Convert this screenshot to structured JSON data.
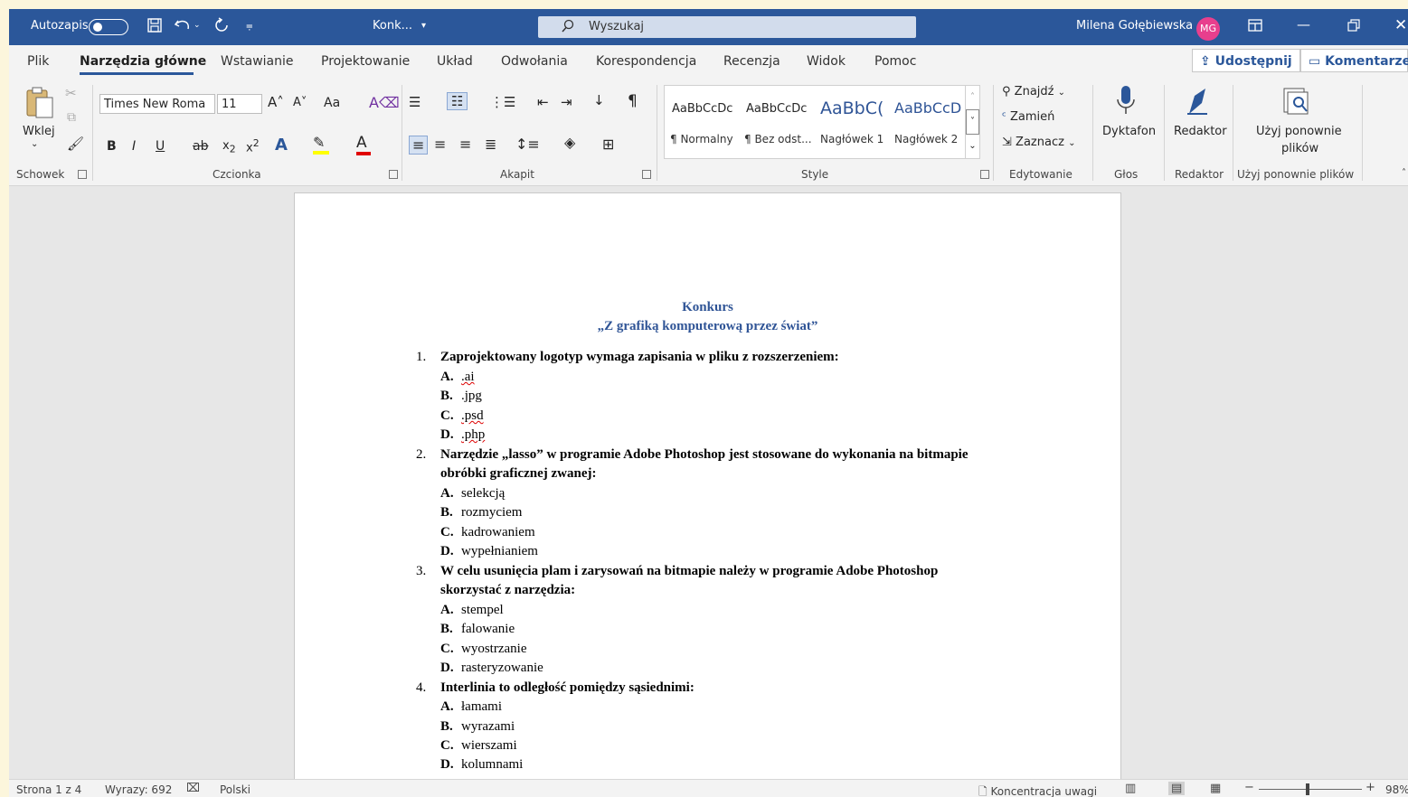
{
  "titlebar": {
    "autosave_label": "Autozapis",
    "doc_name": "Konk...",
    "doc_name_chevron": "▾",
    "search_placeholder": "Wyszukaj",
    "user_name": "Milena Gołębiewska",
    "user_initials": "MG",
    "icons": [
      "save-icon",
      "undo-icon",
      "redo-icon",
      "customize-icon",
      "search-icon",
      "ribbon-display-icon",
      "minimize-icon",
      "restore-icon",
      "close-icon"
    ]
  },
  "tabs": {
    "items": [
      "Plik",
      "Narzędzia główne",
      "Wstawianie",
      "Projektowanie",
      "Układ",
      "Odwołania",
      "Korespondencja",
      "Recenzja",
      "Widok",
      "Pomoc"
    ],
    "active": "Narzędzia główne",
    "share_label": "Udostępnij",
    "comments_label": "Komentarze"
  },
  "ribbon": {
    "clipboard": {
      "paste_label": "Wklej",
      "group_label": "Schowek"
    },
    "font": {
      "font_name": "Times New Roma",
      "font_size": "11",
      "change_case": "Aa",
      "group_label": "Czcionka",
      "bold": "B",
      "italic": "I",
      "underline": "U",
      "strike": "ab",
      "sub": "x",
      "sup": "x"
    },
    "paragraph": {
      "group_label": "Akapit"
    },
    "styles": {
      "samples": [
        "AaBbCcDc",
        "AaBbCcDc",
        "AaBbC(",
        "AaBbCcD"
      ],
      "names": [
        "¶ Normalny",
        "¶ Bez odst...",
        "Nagłówek 1",
        "Nagłówek 2"
      ],
      "group_label": "Style"
    },
    "editing": {
      "find": "Znajdź",
      "replace": "Zamień",
      "select": "Zaznacz",
      "group_label": "Edytowanie"
    },
    "voice": {
      "dictate": "Dyktafon",
      "group_label": "Głos"
    },
    "editor": {
      "label": "Redaktor",
      "group_label": "Redaktor"
    },
    "reuse": {
      "label_line1": "Użyj ponownie",
      "label_line2": "plików",
      "group_label": "Użyj ponownie plików"
    }
  },
  "document": {
    "title_line1": "Konkurs",
    "title_line2": "„Z grafiką komputerową przez świat”",
    "questions": [
      {
        "num": "1.",
        "lines": [
          "Zaprojektowany logotyp wymaga zapisania w pliku z rozszerzeniem:"
        ],
        "answers": [
          [
            "A.",
            ".ai"
          ],
          [
            "B.",
            ".jpg"
          ],
          [
            "C.",
            ".psd"
          ],
          [
            "D.",
            ".php"
          ]
        ]
      },
      {
        "num": "2.",
        "lines": [
          "Narzędzie „lasso” w programie Adobe Photoshop jest stosowane do wykonania na bitmapie",
          "obróbki graficznej zwanej:"
        ],
        "answers": [
          [
            "A.",
            "selekcją"
          ],
          [
            "B.",
            "rozmyciem"
          ],
          [
            "C.",
            "kadrowaniem"
          ],
          [
            "D.",
            "wypełnianiem"
          ]
        ]
      },
      {
        "num": "3.",
        "lines": [
          "W celu usunięcia plam i zarysowań na bitmapie należy w programie Adobe Photoshop",
          "skorzystać z narzędzia:"
        ],
        "answers": [
          [
            "A.",
            "stempel"
          ],
          [
            "B.",
            "falowanie"
          ],
          [
            "C.",
            "wyostrzanie"
          ],
          [
            "D.",
            "rasteryzowanie"
          ]
        ]
      },
      {
        "num": "4.",
        "lines": [
          "Interlinia to odległość pomiędzy sąsiednimi:"
        ],
        "answers": [
          [
            "A.",
            "łamami"
          ],
          [
            "B.",
            "wyrazami"
          ],
          [
            "C.",
            "wierszami"
          ],
          [
            "D.",
            "kolumnami"
          ]
        ]
      }
    ]
  },
  "statusbar": {
    "page": "Strona 1 z 4",
    "words": "Wyrazy: 692",
    "language": "Polski",
    "focus": "Koncentracja uwagi",
    "zoom": "98%"
  }
}
